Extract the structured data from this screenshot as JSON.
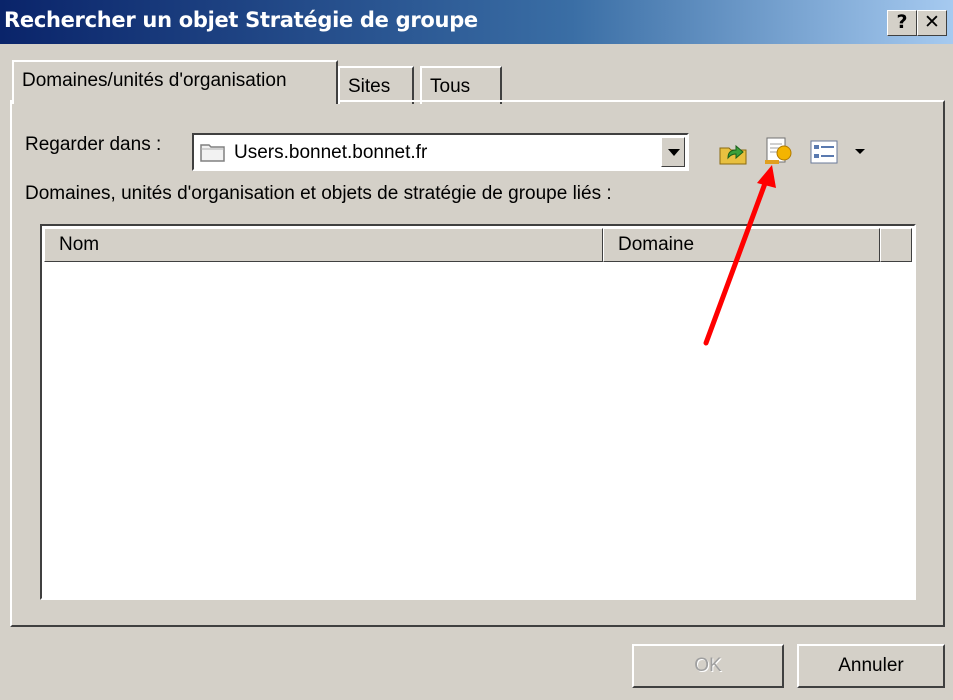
{
  "window": {
    "title": "Rechercher un objet Stratégie de groupe",
    "help_label": "?",
    "close_label": "✕"
  },
  "tabs": [
    {
      "label": "Domaines/unités d'organisation",
      "active": true
    },
    {
      "label": "Sites",
      "active": false
    },
    {
      "label": "Tous",
      "active": false
    }
  ],
  "look_in": {
    "label": "Regarder dans :",
    "value": "Users.bonnet.bonnet.fr"
  },
  "toolbar": {
    "icons": [
      "up-folder-icon",
      "new-gpo-icon",
      "view-menu-icon",
      "chevron-down-icon"
    ]
  },
  "list": {
    "label": "Domaines, unités d'organisation et objets de stratégie de groupe liés :",
    "columns": [
      "Nom",
      "Domaine"
    ],
    "rows": []
  },
  "buttons": {
    "ok": "OK",
    "cancel": "Annuler"
  },
  "annotation": {
    "color": "#ff0000"
  }
}
